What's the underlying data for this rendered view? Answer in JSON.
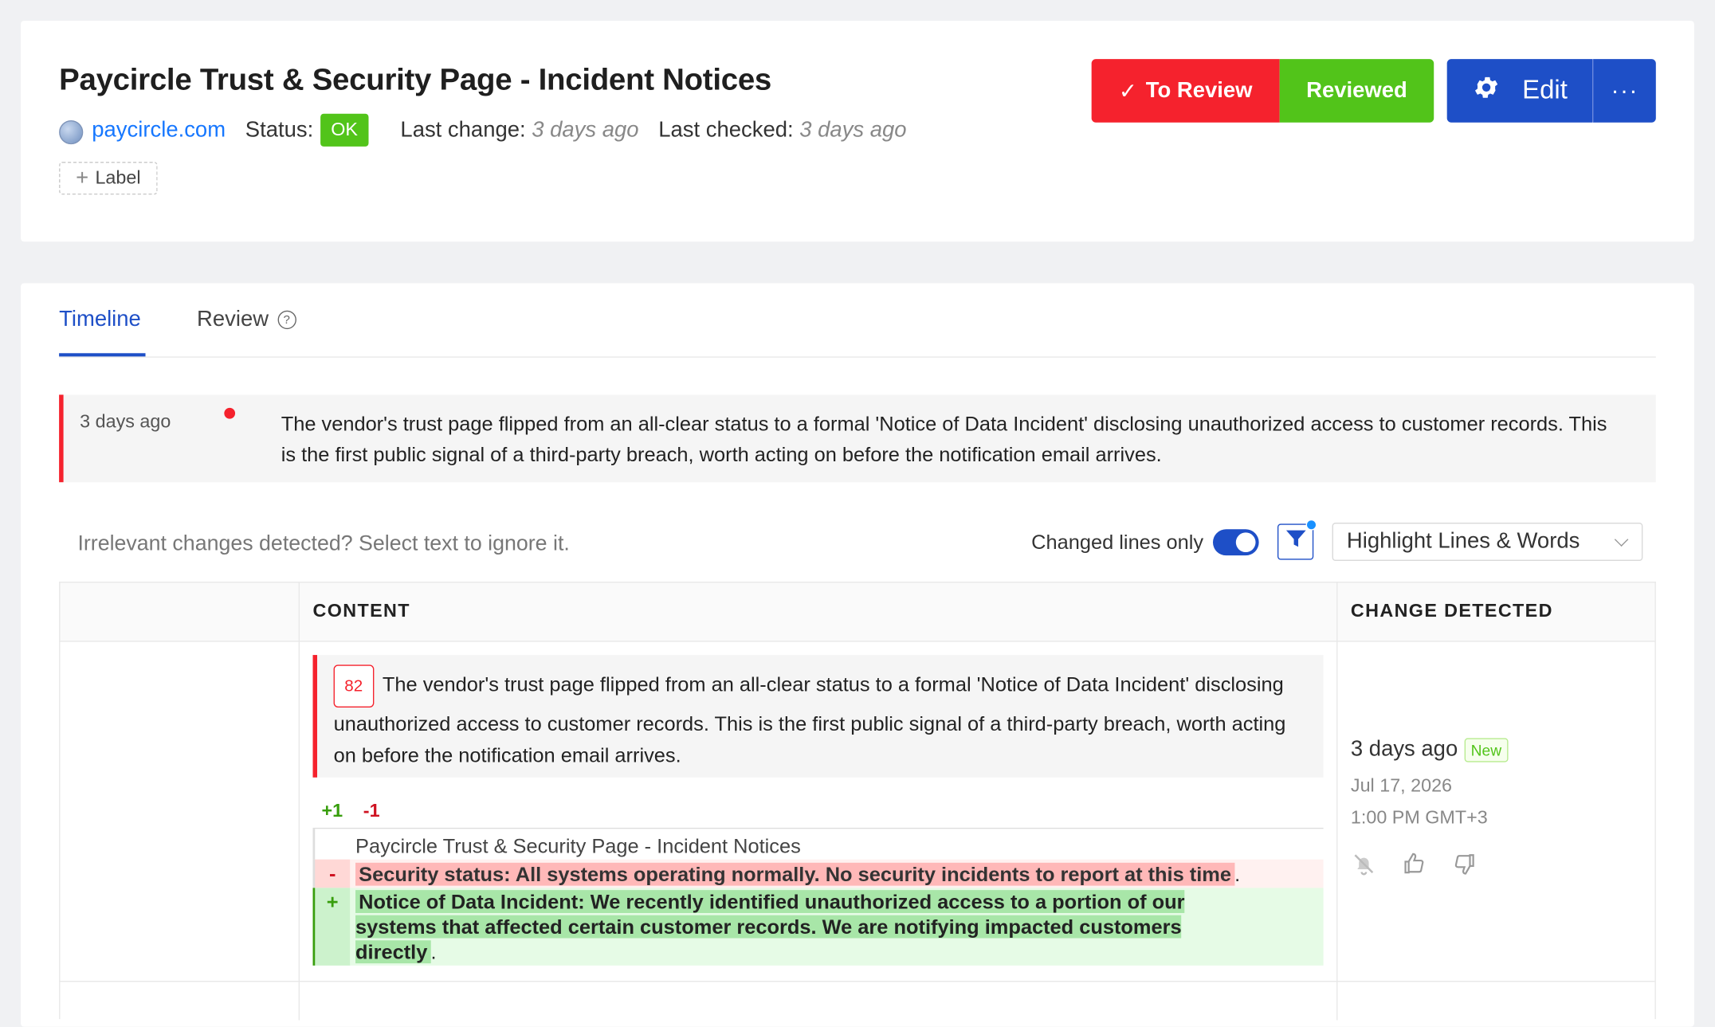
{
  "header": {
    "title": "Paycircle Trust & Security Page - Incident Notices",
    "site": "paycircle.com",
    "status_label": "Status:",
    "status_value": "OK",
    "last_change_label": "Last change:",
    "last_change_value": "3 days ago",
    "last_checked_label": "Last checked:",
    "last_checked_value": "3 days ago",
    "label_button": "Label",
    "to_review_button": "To Review",
    "reviewed_button": "Reviewed",
    "edit_button": "Edit",
    "more_button": "···"
  },
  "tabs": [
    {
      "label": "Timeline",
      "active": true
    },
    {
      "label": "Review",
      "active": false
    }
  ],
  "summary": {
    "time": "3 days ago",
    "text": "The vendor's trust page flipped from an all-clear status to a formal 'Notice of Data Incident' disclosing unauthorized access to customer records. This is the first public signal of a third-party breach, worth acting on before the notification email arrives."
  },
  "toolbar": {
    "hint": "Irrelevant changes detected? Select text to ignore it.",
    "changed_lines_label": "Changed lines only",
    "changed_lines_on": true,
    "highlight_mode": "Highlight Lines & Words"
  },
  "table": {
    "headers": [
      "",
      "CONTENT",
      "CHANGE DETECTED"
    ],
    "row": {
      "score": "82",
      "summary": "The vendor's trust page flipped from an all-clear status to a formal 'Notice of Data Incident' disclosing unauthorized access to customer records. This is the first public signal of a third-party breach, worth acting on before the notification email arrives.",
      "added_count": "+1",
      "removed_count": "-1",
      "context_line": "Paycircle Trust & Security Page - Incident Notices",
      "deleted_marker": "-",
      "deleted_text": "Security status: All systems operating normally. No security incidents to report at this time",
      "deleted_trail": ".",
      "added_marker": "+",
      "added_text": "Notice of Data Incident: We recently identified unauthorized access to a portion of our systems that affected certain customer records. We are notifying impacted customers directly",
      "added_trail": ".",
      "detected_time": "3 days ago",
      "new_badge": "New",
      "detected_date": "Jul 17, 2026",
      "detected_clock": "1:00 PM GMT+3"
    }
  },
  "colors": {
    "accent": "#1e4fc7",
    "danger": "#f5222d",
    "success": "#52c41a"
  }
}
